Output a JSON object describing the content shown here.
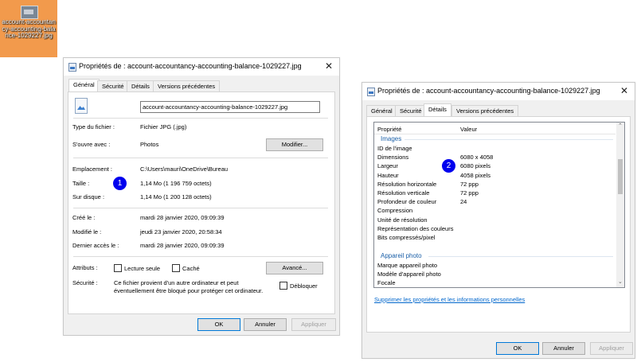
{
  "desktop_icon": {
    "label": "account-accountancy-accounting-balance-1029227.jpg"
  },
  "win1": {
    "title": "Propriétés de : account-accountancy-accounting-balance-1029227.jpg",
    "tabs": [
      "Général",
      "Sécurité",
      "Détails",
      "Versions précédentes"
    ],
    "filename": "account-accountancy-accounting-balance-1029227.jpg",
    "type_label": "Type du fichier :",
    "type_value": "Fichier JPG (.jpg)",
    "open_label": "S'ouvre avec :",
    "open_value": "Photos",
    "modify_btn": "Modifier...",
    "location_label": "Emplacement :",
    "location_value": "C:\\Users\\mauri\\OneDrive\\Bureau",
    "size_label": "Taille :",
    "size_value": "1,14 Mo (1 196 759 octets)",
    "disk_label": "Sur disque :",
    "disk_value": "1,14 Mo (1 200 128 octets)",
    "created_label": "Créé le :",
    "created_value": "mardi 28 janvier 2020, 09:09:39",
    "modified_label": "Modifié le :",
    "modified_value": "jeudi 23 janvier 2020, 20:58:34",
    "accessed_label": "Dernier accès le :",
    "accessed_value": "mardi 28 janvier 2020, 09:09:39",
    "attr_label": "Attributs :",
    "readonly": "Lecture seule",
    "hidden": "Caché",
    "advanced_btn": "Avancé...",
    "security_label": "Sécurité :",
    "security_text_1": "Ce fichier provient d'un autre ordinateur et peut",
    "security_text_2": "éventuellement être bloqué pour protéger cet ordinateur.",
    "unblock": "Débloquer",
    "ok": "OK",
    "cancel": "Annuler",
    "apply": "Appliquer",
    "badge": "1"
  },
  "win2": {
    "title": "Propriétés de : account-accountancy-accounting-balance-1029227.jpg",
    "tabs": [
      "Général",
      "Sécurité",
      "Détails",
      "Versions précédentes"
    ],
    "col_property": "Propriété",
    "col_value": "Valeur",
    "group_images": "Images",
    "rows_images": [
      {
        "name": "ID de l'image",
        "value": ""
      },
      {
        "name": "Dimensions",
        "value": "6080 x 4058"
      },
      {
        "name": "Largeur",
        "value": "6080 pixels"
      },
      {
        "name": "Hauteur",
        "value": "4058 pixels"
      },
      {
        "name": "Résolution horizontale",
        "value": "72 ppp"
      },
      {
        "name": "Résolution verticale",
        "value": "72 ppp"
      },
      {
        "name": "Profondeur de couleur",
        "value": "24"
      },
      {
        "name": "Compression",
        "value": ""
      },
      {
        "name": "Unité de résolution",
        "value": ""
      },
      {
        "name": "Représentation des couleurs",
        "value": ""
      },
      {
        "name": "Bits compressés/pixel",
        "value": ""
      }
    ],
    "group_camera": "Appareil photo",
    "rows_camera": [
      {
        "name": "Marque appareil photo",
        "value": ""
      },
      {
        "name": "Modèle d'appareil photo",
        "value": ""
      },
      {
        "name": "Focale",
        "value": ""
      }
    ],
    "remove_link": "Supprimer les propriétés et les informations personnelles",
    "ok": "OK",
    "cancel": "Annuler",
    "apply": "Appliquer",
    "badge": "2"
  }
}
